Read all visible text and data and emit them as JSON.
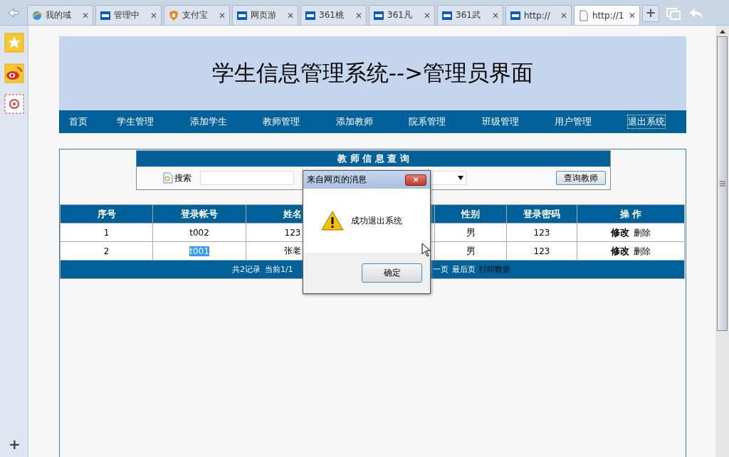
{
  "browser": {
    "tabs": [
      {
        "title": "我的域",
        "kind": "ie",
        "close": "✕",
        "selected": false
      },
      {
        "title": "管理中",
        "kind": "g361",
        "close": "✕",
        "selected": false
      },
      {
        "title": "支付宝",
        "kind": "alipay",
        "close": "✕",
        "selected": false
      },
      {
        "title": "网页游",
        "kind": "g361",
        "close": "✕",
        "selected": false
      },
      {
        "title": "361桃",
        "kind": "g361",
        "close": "✕",
        "selected": false
      },
      {
        "title": "361凡",
        "kind": "g361",
        "close": "✕",
        "selected": false
      },
      {
        "title": "361武",
        "kind": "g361",
        "close": "✕",
        "selected": false
      },
      {
        "title": "http://",
        "kind": "g361",
        "close": "✕",
        "selected": false
      },
      {
        "title": "http://1",
        "kind": "page",
        "close": "✕",
        "selected": true
      }
    ],
    "new_tab": "+",
    "sidebar": [
      {
        "kind": "star"
      },
      {
        "kind": "weibo"
      },
      {
        "kind": "mail"
      }
    ],
    "sidebar_add": "+"
  },
  "header": {
    "title": "学生信息管理系统-->管理员界面"
  },
  "nav": [
    {
      "label": "首页",
      "focused": false
    },
    {
      "label": "学生管理",
      "focused": false
    },
    {
      "label": "添加学生",
      "focused": false
    },
    {
      "label": "教师管理",
      "focused": false
    },
    {
      "label": "添加教师",
      "focused": false
    },
    {
      "label": "院系管理",
      "focused": false
    },
    {
      "label": "班级管理",
      "focused": false
    },
    {
      "label": "用户管理",
      "focused": false
    },
    {
      "label": "退出系统",
      "focused": true
    }
  ],
  "query": {
    "title": "教 师 信 息 查 询",
    "search_label": "搜索",
    "button": "查询教师"
  },
  "table": {
    "columns": [
      "序号",
      "登录帐号",
      "姓名",
      null,
      "性别",
      "登录密码",
      "操 作"
    ],
    "rows": [
      {
        "index": "1",
        "account": "t002",
        "account_highlighted": false,
        "name": "123",
        "gender": "男",
        "password": "123",
        "edit": "修改",
        "delete": "删除"
      },
      {
        "index": "2",
        "account": "t001",
        "account_highlighted": true,
        "name": "张老",
        "gender": "男",
        "password": "123",
        "edit": "修改",
        "delete": "删除"
      }
    ],
    "footer": [
      "共2记录",
      "当前1/1",
      "一页",
      "最后页",
      "打印数据"
    ]
  },
  "dialog": {
    "title": "来自网页的消息",
    "close": "✕",
    "message": "成功退出系统",
    "button": "确定"
  }
}
